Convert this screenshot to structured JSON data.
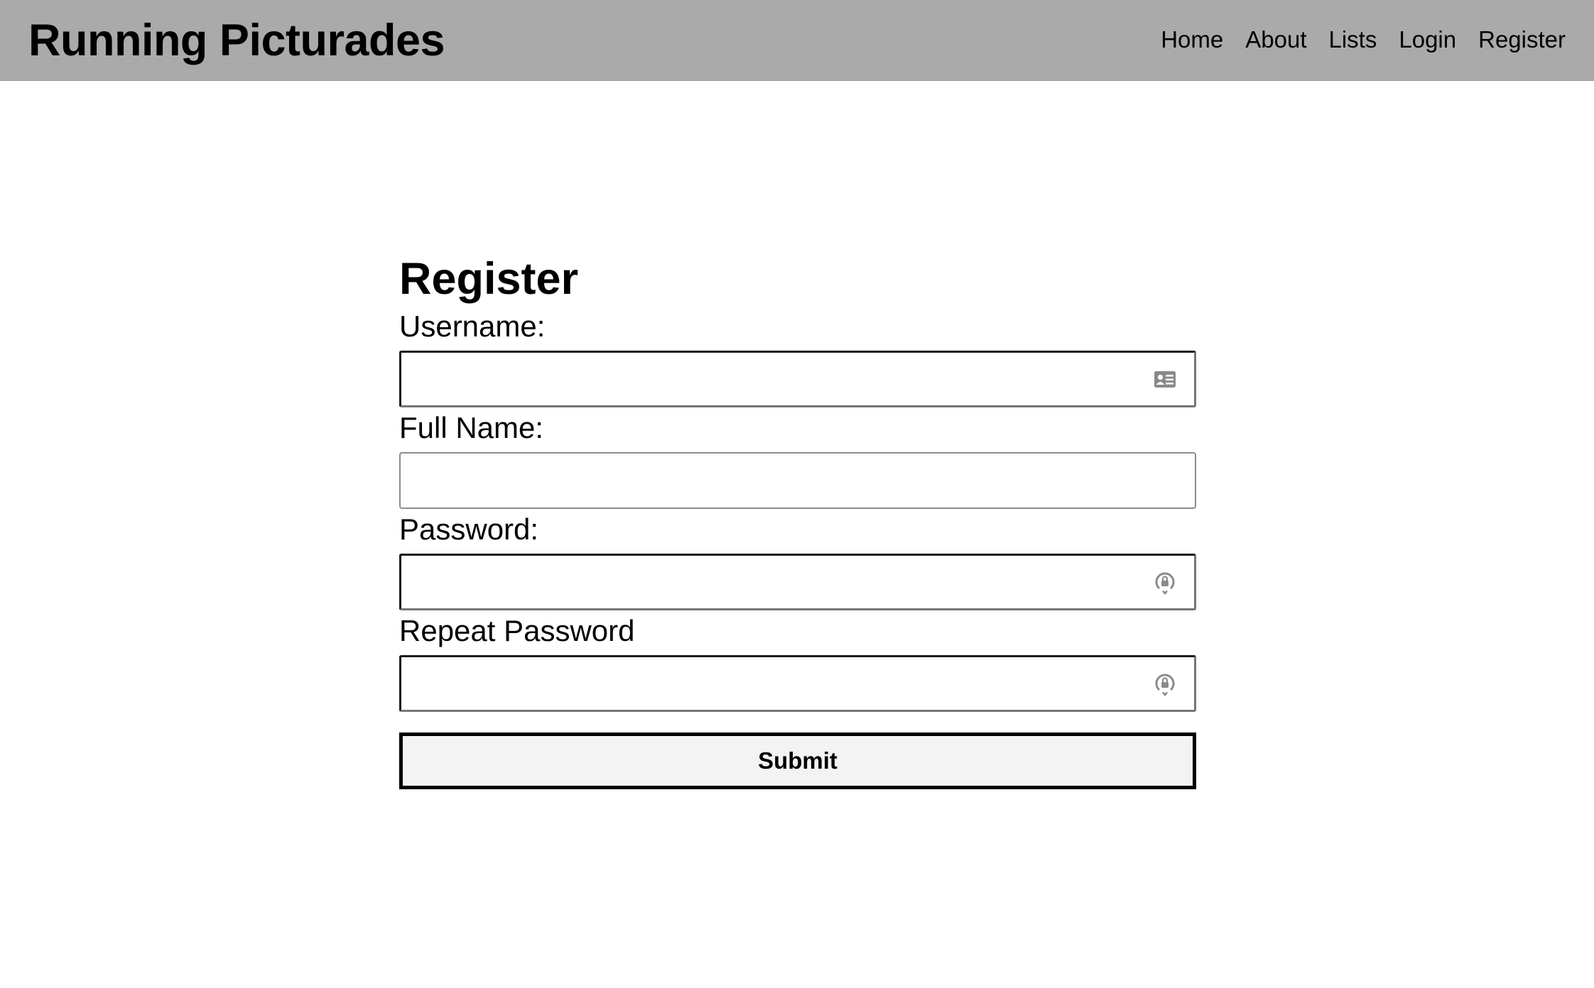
{
  "navbar": {
    "brand": "Running Picturades",
    "links": [
      "Home",
      "About",
      "Lists",
      "Login",
      "Register"
    ]
  },
  "form": {
    "title": "Register",
    "fields": [
      {
        "label": "Username:",
        "value": "",
        "icon": "contact-card-icon"
      },
      {
        "label": "Full Name:",
        "value": ""
      },
      {
        "label": "Password:",
        "value": "",
        "icon": "password-key-icon"
      },
      {
        "label": "Repeat Password",
        "value": "",
        "icon": "password-key-icon"
      }
    ],
    "submit_label": "Submit"
  }
}
